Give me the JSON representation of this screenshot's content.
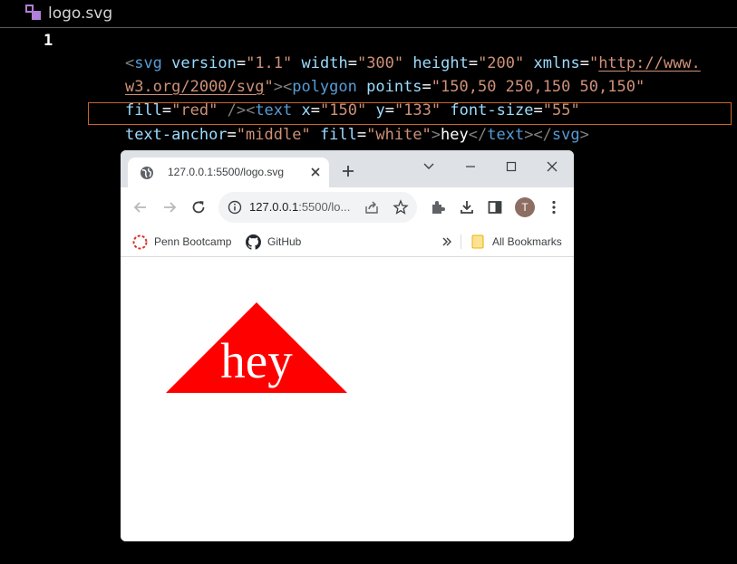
{
  "editor": {
    "file_tab": "logo.svg",
    "line_number": "1",
    "tokens": {
      "l1": [
        "<",
        "svg",
        " ",
        "version",
        "=",
        "\"1.1\"",
        " ",
        "width",
        "=",
        "\"300\"",
        " ",
        "height",
        "=",
        "\"200\"",
        " ",
        "xmlns",
        "=",
        "\"",
        "http://www."
      ],
      "l2": [
        "w3.org/2000/svg",
        "\"",
        "><",
        "polygon",
        " ",
        "points",
        "=",
        "\"150,50 250,150 50,150\""
      ],
      "l3": [
        "fill",
        "=",
        "\"red\"",
        " />",
        "<",
        "text",
        " ",
        "x",
        "=",
        "\"150\"",
        " ",
        "y",
        "=",
        "\"133\"",
        " ",
        "font-size",
        "=",
        "\"55\""
      ],
      "l4": [
        "text-anchor",
        "=",
        "\"middle\"",
        " ",
        "fill",
        "=",
        "\"white\"",
        ">",
        "hey",
        "</",
        "text",
        "></",
        "svg",
        ">"
      ]
    },
    "colors": {
      "tag": "#569cd6",
      "attr": "#9cdcfe",
      "value": "#ce9178",
      "punct": "#808080",
      "highlight_border": "#c9652a"
    }
  },
  "browser": {
    "tab_title": "127.0.0.1:5500/logo.svg",
    "address_host": "127.0.0.1",
    "address_rest": ":5500/lo...",
    "avatar_initial": "T",
    "bookmarks": [
      {
        "label": "Penn Bootcamp",
        "icon": "penn-logo-icon"
      },
      {
        "label": "GitHub",
        "icon": "github-icon"
      }
    ],
    "all_bookmarks_label": "All Bookmarks"
  },
  "svg_output": {
    "text": "hey",
    "fill": "red",
    "text_fill": "white"
  }
}
